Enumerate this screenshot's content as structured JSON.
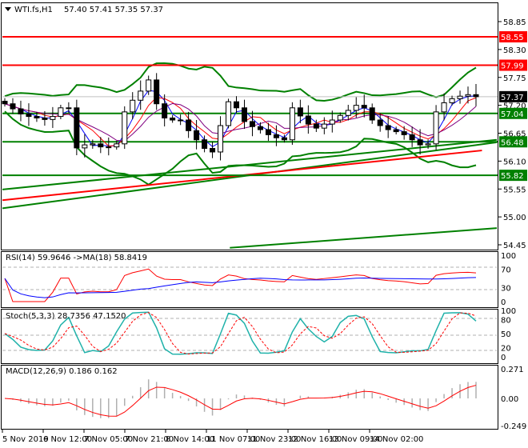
{
  "header": {
    "symbol": "WTI.fs,H1",
    "ohlc": "57.40 57.41 57.35 57.37"
  },
  "chart_data": {
    "type": "line",
    "title": "WTI.fs,H1",
    "price_axis": {
      "ticks": [
        "58.85",
        "58.30",
        "57.75",
        "57.20",
        "56.65",
        "56.10",
        "55.55",
        "55.00",
        "54.45"
      ],
      "ylim": [
        54.45,
        58.85
      ]
    },
    "current_price": "57.37",
    "levels": [
      {
        "value": "58.55",
        "color": "#ff0000"
      },
      {
        "value": "57.99",
        "color": "#ff0000"
      },
      {
        "value": "57.04",
        "color": "#008000"
      },
      {
        "value": "56.48",
        "color": "#008000"
      },
      {
        "value": "55.82",
        "color": "#008000"
      }
    ],
    "trendlines": [
      {
        "color": "#008000",
        "from": [
          0,
          55.54
        ],
        "to": [
          1,
          56.52
        ]
      },
      {
        "color": "#008000",
        "from": [
          0,
          55.17
        ],
        "to": [
          1,
          56.47
        ]
      },
      {
        "color": "#ff0000",
        "from": [
          0,
          55.33
        ],
        "to": [
          0.97,
          56.31
        ]
      },
      {
        "color": "#008000",
        "from": [
          0.46,
          54.39
        ],
        "to": [
          1,
          54.78
        ]
      }
    ],
    "x_labels": [
      "5 Nov 2019",
      "6 Nov 12:00",
      "7 Nov 05:00",
      "7 Nov 21:00",
      "8 Nov 14:00",
      "11 Nov 07:00",
      "11 Nov 23:00",
      "12 Nov 16:00",
      "13 Nov 09:00",
      "14 Nov 02:00"
    ],
    "closes": [
      57.23,
      57.13,
      57.03,
      56.98,
      56.95,
      56.92,
      56.98,
      57.15,
      57.15,
      56.36,
      56.42,
      56.44,
      56.38,
      56.38,
      56.44,
      57.07,
      57.3,
      57.48,
      57.7,
      57.23,
      56.95,
      56.91,
      56.91,
      56.7,
      56.52,
      56.35,
      56.28,
      56.8,
      57.27,
      57.15,
      56.88,
      56.78,
      56.72,
      56.62,
      56.56,
      56.52,
      57.15,
      56.99,
      56.83,
      56.75,
      56.83,
      56.91,
      57.0,
      57.1,
      57.2,
      57.15,
      56.91,
      56.8,
      56.72,
      56.68,
      56.62,
      56.52,
      56.42,
      56.44,
      57.07,
      57.25,
      57.33,
      57.38,
      57.41,
      57.37
    ],
    "rsi": {
      "label": "RSI(14) 59.9646  ->MA(18) 58.8419",
      "ticks": [
        "100",
        "70",
        "30",
        "0"
      ]
    },
    "stoch": {
      "label": "Stoch(5,3,3) 28.7356 47.1520",
      "ticks": [
        "100",
        "80",
        "50",
        "20",
        "0"
      ]
    },
    "macd": {
      "label": "MACD(12,26,9) 0.186 0.162",
      "ticks": [
        "0.271",
        "0.00",
        "-0.249"
      ],
      "ylim": [
        -0.249,
        0.271
      ]
    }
  }
}
